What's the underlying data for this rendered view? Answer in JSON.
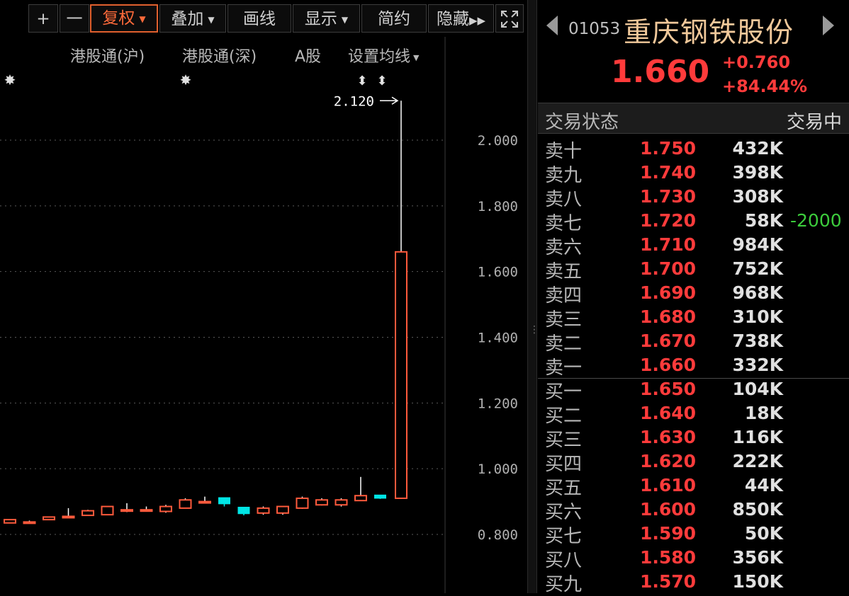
{
  "toolbar": {
    "plus": "+",
    "minus": "一",
    "fuquan": "复权",
    "diejia": "叠加",
    "huaxian": "画线",
    "xianshi": "显示",
    "jianyue": "简约",
    "yincang": "隐藏"
  },
  "submenu": {
    "ggt_hu": "港股通(沪)",
    "ggt_shen": "港股通(深)",
    "a_share": "A股",
    "set_ma": "设置均线"
  },
  "chart_data": {
    "type": "candlestick",
    "y_ticks": [
      "2.000",
      "1.800",
      "1.600",
      "1.400",
      "1.200",
      "1.000",
      "0.800"
    ],
    "ylim": [
      0.78,
      2.24
    ],
    "high_marker": "2.120",
    "candles": [
      {
        "open": 0.835,
        "close": 0.845,
        "high": 0.845,
        "low": 0.835,
        "color": "up"
      },
      {
        "open": 0.838,
        "close": 0.838,
        "high": 0.842,
        "low": 0.834,
        "color": "up"
      },
      {
        "open": 0.845,
        "close": 0.853,
        "high": 0.853,
        "low": 0.845,
        "color": "up"
      },
      {
        "open": 0.855,
        "close": 0.855,
        "high": 0.88,
        "low": 0.855,
        "color": "up"
      },
      {
        "open": 0.858,
        "close": 0.872,
        "high": 0.875,
        "low": 0.858,
        "color": "up"
      },
      {
        "open": 0.86,
        "close": 0.885,
        "high": 0.885,
        "low": 0.86,
        "color": "up"
      },
      {
        "open": 0.875,
        "close": 0.875,
        "high": 0.895,
        "low": 0.868,
        "color": "up"
      },
      {
        "open": 0.875,
        "close": 0.875,
        "high": 0.885,
        "low": 0.872,
        "color": "up"
      },
      {
        "open": 0.87,
        "close": 0.885,
        "high": 0.89,
        "low": 0.866,
        "color": "up"
      },
      {
        "open": 0.88,
        "close": 0.905,
        "high": 0.91,
        "low": 0.88,
        "color": "up"
      },
      {
        "open": 0.9,
        "close": 0.9,
        "high": 0.915,
        "low": 0.895,
        "color": "up"
      },
      {
        "open": 0.912,
        "close": 0.893,
        "high": 0.912,
        "low": 0.885,
        "color": "down"
      },
      {
        "open": 0.883,
        "close": 0.863,
        "high": 0.883,
        "low": 0.858,
        "color": "down"
      },
      {
        "open": 0.865,
        "close": 0.88,
        "high": 0.885,
        "low": 0.86,
        "color": "up"
      },
      {
        "open": 0.865,
        "close": 0.885,
        "high": 0.885,
        "low": 0.86,
        "color": "up"
      },
      {
        "open": 0.88,
        "close": 0.91,
        "high": 0.915,
        "low": 0.878,
        "color": "up"
      },
      {
        "open": 0.89,
        "close": 0.905,
        "high": 0.91,
        "low": 0.888,
        "color": "up"
      },
      {
        "open": 0.89,
        "close": 0.905,
        "high": 0.91,
        "low": 0.885,
        "color": "up"
      },
      {
        "open": 0.903,
        "close": 0.918,
        "high": 0.975,
        "low": 0.903,
        "color": "up"
      },
      {
        "open": 0.92,
        "close": 0.91,
        "high": 0.92,
        "low": 0.908,
        "color": "down"
      },
      {
        "open": 0.91,
        "close": 1.66,
        "high": 2.12,
        "low": 0.908,
        "color": "up"
      }
    ]
  },
  "quote": {
    "code": "01053",
    "name": "重庆钢铁股份",
    "price": "1.660",
    "change": "+0.760",
    "change_pct": "+84.44%",
    "status_label": "交易状态",
    "status_value": "交易中"
  },
  "orderbook": {
    "asks": [
      {
        "label": "卖十",
        "price": "1.750",
        "vol": "432K",
        "chg": ""
      },
      {
        "label": "卖九",
        "price": "1.740",
        "vol": "398K",
        "chg": ""
      },
      {
        "label": "卖八",
        "price": "1.730",
        "vol": "308K",
        "chg": ""
      },
      {
        "label": "卖七",
        "price": "1.720",
        "vol": "58K",
        "chg": "-2000"
      },
      {
        "label": "卖六",
        "price": "1.710",
        "vol": "984K",
        "chg": ""
      },
      {
        "label": "卖五",
        "price": "1.700",
        "vol": "752K",
        "chg": ""
      },
      {
        "label": "卖四",
        "price": "1.690",
        "vol": "968K",
        "chg": ""
      },
      {
        "label": "卖三",
        "price": "1.680",
        "vol": "310K",
        "chg": ""
      },
      {
        "label": "卖二",
        "price": "1.670",
        "vol": "738K",
        "chg": ""
      },
      {
        "label": "卖一",
        "price": "1.660",
        "vol": "332K",
        "chg": ""
      }
    ],
    "bids": [
      {
        "label": "买一",
        "price": "1.650",
        "vol": "104K",
        "chg": ""
      },
      {
        "label": "买二",
        "price": "1.640",
        "vol": "18K",
        "chg": ""
      },
      {
        "label": "买三",
        "price": "1.630",
        "vol": "116K",
        "chg": ""
      },
      {
        "label": "买四",
        "price": "1.620",
        "vol": "222K",
        "chg": ""
      },
      {
        "label": "买五",
        "price": "1.610",
        "vol": "44K",
        "chg": ""
      },
      {
        "label": "买六",
        "price": "1.600",
        "vol": "850K",
        "chg": ""
      },
      {
        "label": "买七",
        "price": "1.590",
        "vol": "50K",
        "chg": ""
      },
      {
        "label": "买八",
        "price": "1.580",
        "vol": "356K",
        "chg": ""
      },
      {
        "label": "买九",
        "price": "1.570",
        "vol": "150K",
        "chg": ""
      }
    ]
  },
  "colors": {
    "up": "#ff5a3c",
    "down": "#00e5e5",
    "grid": "#5a5a5a",
    "accent": "#ff6a3a"
  }
}
